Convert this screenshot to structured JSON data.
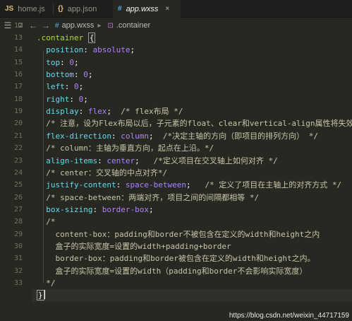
{
  "tabs": [
    {
      "label": "home.js",
      "icon": "JS",
      "close": "",
      "active": false
    },
    {
      "label": "app.json",
      "icon": "{}",
      "close": "",
      "active": false
    },
    {
      "label": "app.wxss",
      "icon": "#",
      "close": "×",
      "active": true
    }
  ],
  "nav": {
    "menu_icon": "☰",
    "bookmark_icon": "⌑",
    "back_icon": "←",
    "forward_icon": "→",
    "crumbs": [
      "app.wxss",
      ".container"
    ]
  },
  "editor": {
    "line_numbers": [
      "13",
      "14",
      "15",
      "16",
      "17",
      "18",
      "19",
      "20",
      "21",
      "22",
      "23",
      "24",
      "25",
      "26",
      "27",
      "28",
      "29",
      "30",
      "31",
      "32",
      "33"
    ],
    "lines": [
      [
        {
          "t": ".container",
          "c": "sel"
        },
        {
          "t": " ",
          "c": "pun"
        },
        {
          "t": "{",
          "c": "brace-box"
        }
      ],
      [
        {
          "t": "  ",
          "c": "pun"
        },
        {
          "t": "position",
          "c": "prop"
        },
        {
          "t": ": ",
          "c": "pun"
        },
        {
          "t": "absolute",
          "c": "val"
        },
        {
          "t": ";",
          "c": "pun"
        }
      ],
      [
        {
          "t": "  ",
          "c": "pun"
        },
        {
          "t": "top",
          "c": "prop"
        },
        {
          "t": ": ",
          "c": "pun"
        },
        {
          "t": "0",
          "c": "val"
        },
        {
          "t": ";",
          "c": "pun"
        }
      ],
      [
        {
          "t": "  ",
          "c": "pun"
        },
        {
          "t": "bottom",
          "c": "prop"
        },
        {
          "t": ": ",
          "c": "pun"
        },
        {
          "t": "0",
          "c": "val"
        },
        {
          "t": ";",
          "c": "pun"
        }
      ],
      [
        {
          "t": "  ",
          "c": "pun"
        },
        {
          "t": "left",
          "c": "prop"
        },
        {
          "t": ": ",
          "c": "pun"
        },
        {
          "t": "0",
          "c": "val"
        },
        {
          "t": ";",
          "c": "pun"
        }
      ],
      [
        {
          "t": "  ",
          "c": "pun"
        },
        {
          "t": "right",
          "c": "prop"
        },
        {
          "t": ": ",
          "c": "pun"
        },
        {
          "t": "0",
          "c": "val"
        },
        {
          "t": ";",
          "c": "pun"
        }
      ],
      [
        {
          "t": "  ",
          "c": "pun"
        },
        {
          "t": "display",
          "c": "prop"
        },
        {
          "t": ": ",
          "c": "pun"
        },
        {
          "t": "flex",
          "c": "val"
        },
        {
          "t": ";  ",
          "c": "pun"
        },
        {
          "t": "/* flex布局 */",
          "c": "cm"
        }
      ],
      [
        {
          "t": "  ",
          "c": "pun"
        },
        {
          "t": "/* 注意，设为Flex布局以后，子元素的float、clear和vertical-align属性将失效。 */",
          "c": "cm"
        }
      ],
      [
        {
          "t": "  ",
          "c": "pun"
        },
        {
          "t": "flex-direction",
          "c": "prop"
        },
        {
          "t": ": ",
          "c": "pun"
        },
        {
          "t": "column",
          "c": "val"
        },
        {
          "t": ";  ",
          "c": "pun"
        },
        {
          "t": "/*决定主轴的方向（即项目的排列方向） */",
          "c": "cm"
        }
      ],
      [
        {
          "t": "  ",
          "c": "pun"
        },
        {
          "t": "/* column：主轴为垂直方向，起点在上沿。*/",
          "c": "cm"
        }
      ],
      [
        {
          "t": "  ",
          "c": "pun"
        },
        {
          "t": "align-items",
          "c": "prop"
        },
        {
          "t": ": ",
          "c": "pun"
        },
        {
          "t": "center",
          "c": "val"
        },
        {
          "t": ";   ",
          "c": "pun"
        },
        {
          "t": "/*定义项目在交叉轴上如何对齐 */",
          "c": "cm"
        }
      ],
      [
        {
          "t": "  ",
          "c": "pun"
        },
        {
          "t": "/* center：交叉轴的中点对齐*/",
          "c": "cm"
        }
      ],
      [
        {
          "t": "  ",
          "c": "pun"
        },
        {
          "t": "justify-content",
          "c": "prop"
        },
        {
          "t": ": ",
          "c": "pun"
        },
        {
          "t": "space-between",
          "c": "val"
        },
        {
          "t": ";   ",
          "c": "pun"
        },
        {
          "t": "/* 定义了项目在主轴上的对齐方式 */",
          "c": "cm"
        }
      ],
      [
        {
          "t": "  ",
          "c": "pun"
        },
        {
          "t": "/* space-between：两端对齐，项目之间的间隔都相等 */",
          "c": "cm"
        }
      ],
      [
        {
          "t": "  ",
          "c": "pun"
        },
        {
          "t": "box-sizing",
          "c": "prop"
        },
        {
          "t": ": ",
          "c": "pun"
        },
        {
          "t": "border-box",
          "c": "val"
        },
        {
          "t": ";",
          "c": "pun"
        }
      ],
      [
        {
          "t": "  ",
          "c": "pun"
        },
        {
          "t": "/*",
          "c": "cm"
        }
      ],
      [
        {
          "t": "    ",
          "c": "pun"
        },
        {
          "t": "content-box：padding和border不被包含在定义的width和height之内",
          "c": "cm"
        }
      ],
      [
        {
          "t": "    ",
          "c": "pun"
        },
        {
          "t": "盒子的实际宽度=设置的width+padding+border",
          "c": "cm"
        }
      ],
      [
        {
          "t": "    ",
          "c": "pun"
        },
        {
          "t": "border-box：padding和border被包含在定义的width和height之内。",
          "c": "cm"
        }
      ],
      [
        {
          "t": "    ",
          "c": "pun"
        },
        {
          "t": "盒子的实际宽度=设置的width（padding和border不会影响实际宽度）",
          "c": "cm"
        }
      ],
      [
        {
          "t": "  ",
          "c": "pun"
        },
        {
          "t": "*/",
          "c": "cm"
        }
      ],
      [
        {
          "t": "}",
          "c": "brace-box"
        }
      ]
    ],
    "first_line_number": "12",
    "cursor_line_index": 21
  },
  "watermark": "https://blog.csdn.net/weixin_44717159",
  "colors": {
    "background": "#272822",
    "selector": "#a6e22e",
    "property": "#66d9ef",
    "value": "#ae81ff",
    "comment": "#c9c5a8"
  }
}
